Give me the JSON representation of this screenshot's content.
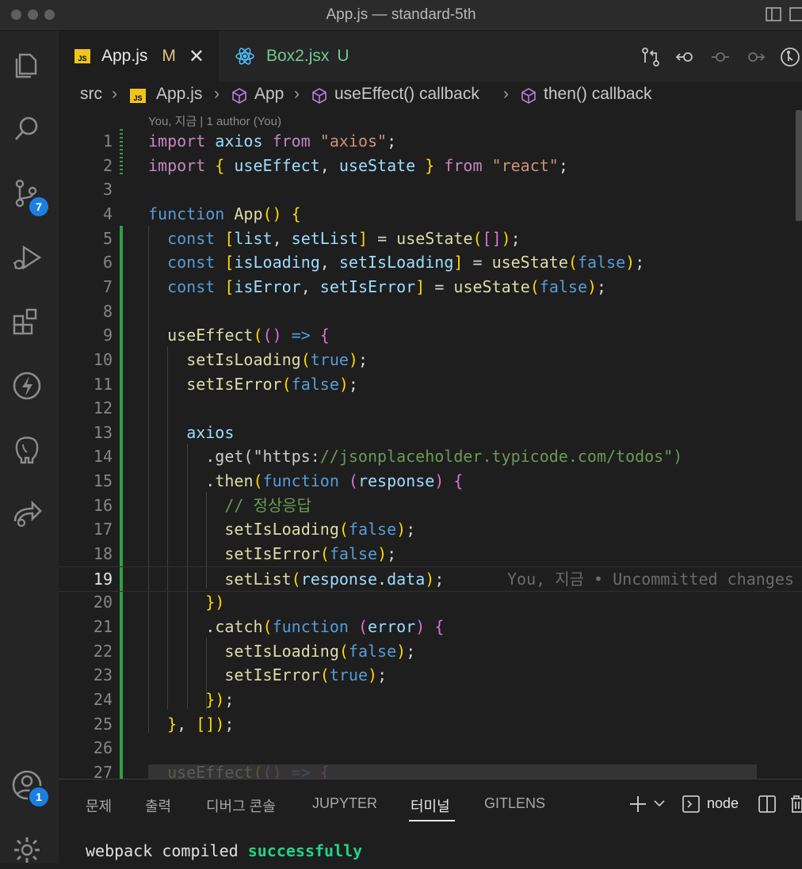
{
  "window": {
    "title": "App.js — standard-5th"
  },
  "activity_bar": {
    "source_control_badge": "7",
    "accounts_badge": "1"
  },
  "tabs": [
    {
      "name": "App.js",
      "status": "M"
    },
    {
      "name": "Box2.jsx",
      "status": "U"
    }
  ],
  "breadcrumb": [
    "src",
    "App.js",
    "App",
    "useEffect() callback",
    "then() callback"
  ],
  "blame_header": "You, 지금 | 1 author (You)",
  "inline_blame": "You, 지금 • Uncommitted changes",
  "code_line_numbers": [
    "1",
    "2",
    "3",
    "4",
    "5",
    "6",
    "7",
    "8",
    "9",
    "10",
    "11",
    "12",
    "13",
    "14",
    "15",
    "16",
    "17",
    "18",
    "19",
    "20",
    "21",
    "22",
    "23",
    "24",
    "25",
    "26",
    "27"
  ],
  "code_lines": [
    "import axios from \"axios\";",
    "import { useEffect, useState } from \"react\";",
    "",
    "function App() {",
    "  const [list, setList] = useState([]);",
    "  const [isLoading, setIsLoading] = useState(false);",
    "  const [isError, setIsError] = useState(false);",
    "",
    "  useEffect(() => {",
    "    setIsLoading(true);",
    "    setIsError(false);",
    "",
    "    axios",
    "      .get(\"https://jsonplaceholder.typicode.com/todos\")",
    "      .then(function (response) {",
    "        // 정상응답",
    "        setIsLoading(false);",
    "        setIsError(false);",
    "        setList(response.data);",
    "      })",
    "      .catch(function (error) {",
    "        setIsLoading(false);",
    "        setIsError(true);",
    "      });",
    "  }, []);",
    "",
    "  useEffect(() => {"
  ],
  "panel": {
    "tabs": [
      "문제",
      "출력",
      "디버그 콘솔",
      "JUPYTER",
      "터미널",
      "GITLENS"
    ],
    "active_tab": "터미널",
    "terminal_name": "node",
    "terminal_output_prefix": "webpack compiled ",
    "terminal_output_status": "successfully"
  },
  "colors": {
    "accent_badge": "#1c7fe0",
    "git_added": "#2ea043",
    "success": "#23d18b"
  }
}
